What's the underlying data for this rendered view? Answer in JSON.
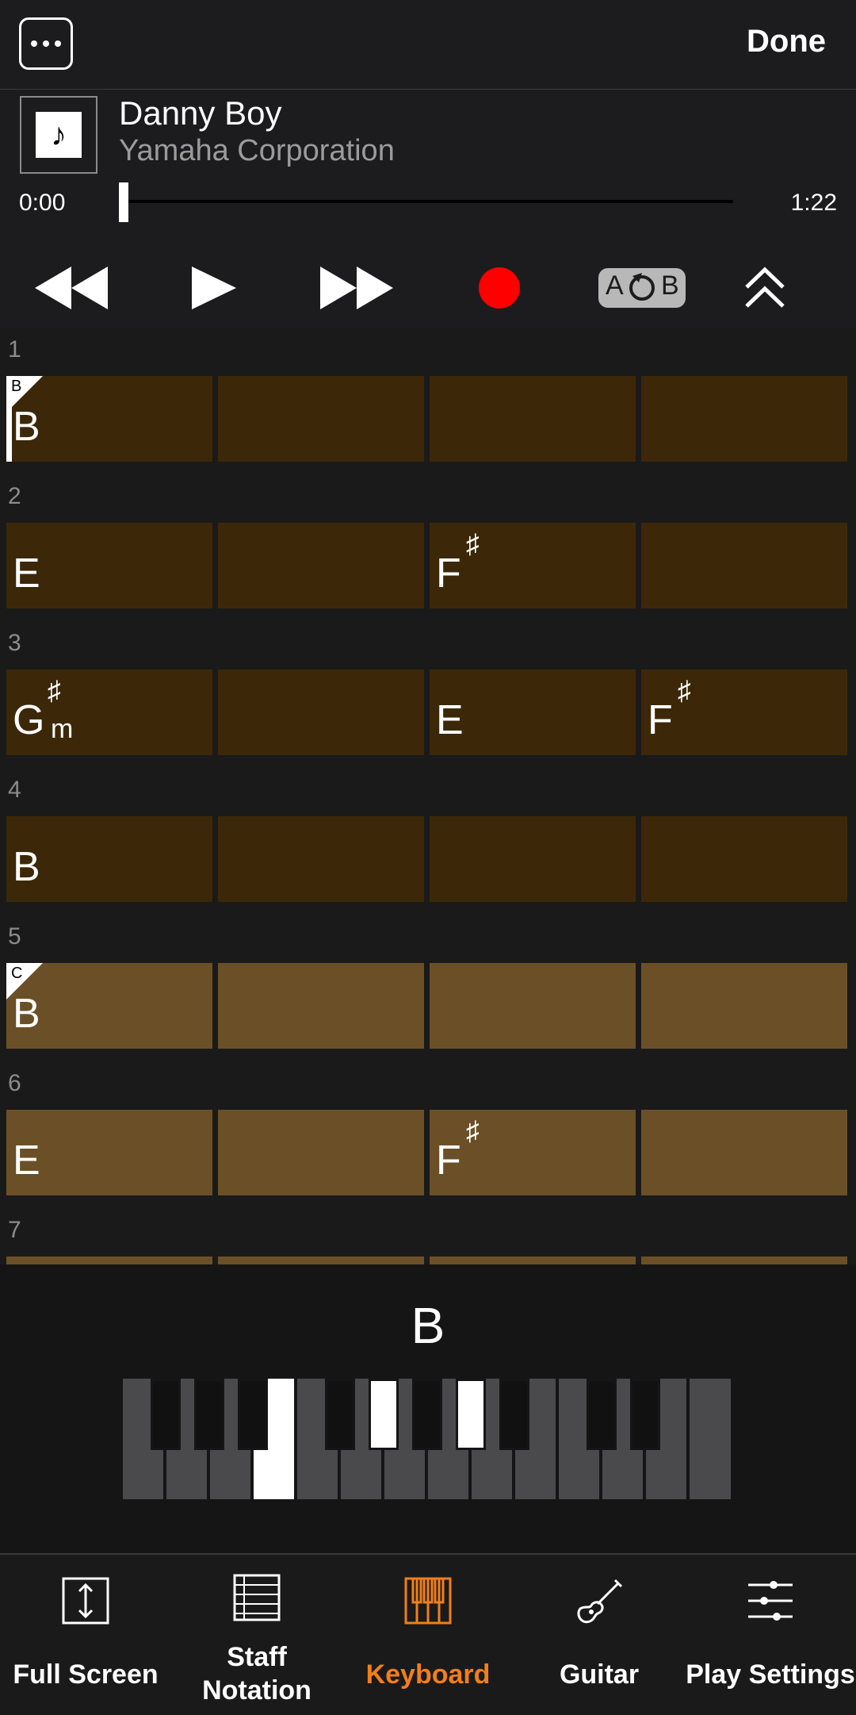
{
  "header": {
    "done_label": "Done"
  },
  "song": {
    "title": "Danny Boy",
    "artist": "Yamaha Corporation",
    "time_start": "0:00",
    "time_end": "1:22",
    "progress": 0.0
  },
  "transport": {
    "ab_label_a": "A",
    "ab_label_b": "B"
  },
  "measures": [
    {
      "num": "1",
      "cells": [
        "B",
        "",
        "",
        ""
      ],
      "section": "B"
    },
    {
      "num": "2",
      "cells": [
        "E",
        "",
        "F#",
        ""
      ]
    },
    {
      "num": "3",
      "cells": [
        "G#m",
        "",
        "E",
        "F#"
      ]
    },
    {
      "num": "4",
      "cells": [
        "B",
        "",
        "",
        ""
      ]
    },
    {
      "num": "5",
      "cells": [
        "B",
        "",
        "",
        ""
      ],
      "section": "C"
    },
    {
      "num": "6",
      "cells": [
        "E",
        "",
        "F#",
        ""
      ]
    },
    {
      "num": "7",
      "cells": [
        "",
        "",
        "",
        ""
      ]
    }
  ],
  "keyboard": {
    "current_chord": "B"
  },
  "nav": [
    {
      "id": "full-screen",
      "label1": "Full Screen",
      "label2": ""
    },
    {
      "id": "staff-notation",
      "label1": "Staff",
      "label2": "Notation"
    },
    {
      "id": "keyboard",
      "label1": "Keyboard",
      "label2": ""
    },
    {
      "id": "guitar",
      "label1": "Guitar",
      "label2": ""
    },
    {
      "id": "play-settings",
      "label1": "Play Settings",
      "label2": ""
    }
  ],
  "colors": {
    "accent": "#f07f1b",
    "record": "#ff0000",
    "chord_dark": "#3c2809",
    "chord_light": "#6b5027"
  }
}
